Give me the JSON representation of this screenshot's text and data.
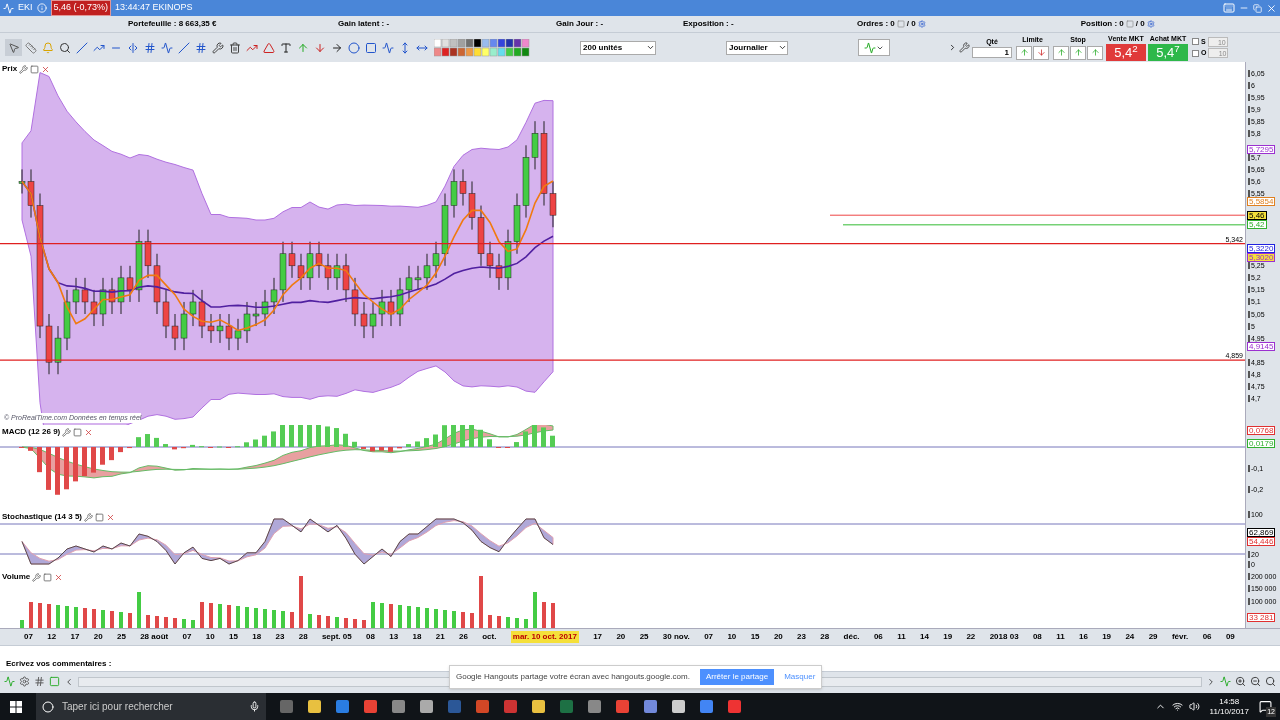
{
  "title_bar": {
    "symbol": "EKI",
    "price_badge": "5,46 (-0,73%)",
    "time_name": "13:44:47 EKINOPS"
  },
  "info_bar": {
    "items": [
      "Portefeuille : 8 663,35 €",
      "Gain latent : -",
      "Gain Jour : -",
      "Exposition : -"
    ],
    "orders": {
      "label": "Ordres : 0",
      "total": "/ 0"
    },
    "position": {
      "label": "Position : 0",
      "total": "/ 0"
    }
  },
  "toolbar": {
    "units": "200 unités",
    "period": "Journalier",
    "qty_label": "Qté",
    "qty": "1",
    "limit_label": "Limite",
    "stop_label": "Stop",
    "sell": {
      "label": "Vente MKT",
      "price": "5,4$^{2}$"
    },
    "buy": {
      "label": "Achat MKT",
      "price": "5,4$^{7}$"
    },
    "options": [
      {
        "label": "S",
        "checked": false,
        "disabled": true,
        "value": "10"
      },
      {
        "label": "O",
        "checked": false,
        "disabled": true,
        "value": "10"
      }
    ]
  },
  "price_pane": {
    "title": "Prix",
    "credit": "© ProRealTime.com Données en temps réel",
    "ticks": [
      "6,05",
      "6",
      "5,95",
      "5,9",
      "5,85",
      "5,8",
      "5,7",
      "5,65",
      "5,6",
      "5,55",
      "5,25",
      "5,2",
      "5,15",
      "5,1",
      "5,05",
      "5",
      "4,95",
      "4,85",
      "4,8",
      "4,75",
      "4,7"
    ],
    "markers": [
      {
        "value": "5,7295",
        "color": "#9b30d0",
        "highlighted": false
      },
      {
        "value": "5,5854",
        "color": "#e08020",
        "highlighted": false
      },
      {
        "value": "5,46",
        "color": "#000000",
        "highlighted": true
      },
      {
        "value": "5,42",
        "color": "#30b030",
        "highlighted": false
      },
      {
        "value": "5,3220",
        "color": "#2020e0",
        "highlighted": false
      },
      {
        "value": "5,3020",
        "color": "#9b30d0",
        "highlighted": true
      },
      {
        "value": "4,9145",
        "color": "#9b30d0",
        "highlighted": false
      }
    ],
    "levels": [
      {
        "label": "5,342"
      },
      {
        "label": "4,859"
      }
    ]
  },
  "macd_pane": {
    "title": "MACD (12 26 9)",
    "ticks": [
      "-0,1",
      "-0,2"
    ],
    "markers": [
      {
        "value": "0,0768",
        "color": "#e03030",
        "highlighted": false
      },
      {
        "value": "0,0179",
        "color": "#30b030",
        "highlighted": false
      }
    ]
  },
  "stoch_pane": {
    "title": "Stochastique (14 3 5)",
    "ticks": [
      "100",
      "20",
      "0"
    ],
    "markers": [
      {
        "value": "62,869",
        "color": "#000000",
        "highlighted": false
      },
      {
        "value": "54,446",
        "color": "#e03030",
        "highlighted": false
      }
    ]
  },
  "volume_pane": {
    "title": "Volume",
    "ticks": [
      "200 000",
      "150 000",
      "100 000"
    ],
    "markers": [
      {
        "value": "33 281",
        "color": "#e03030",
        "highlighted": false
      }
    ]
  },
  "x_axis": [
    {
      "label": "07",
      "selected": false
    },
    {
      "label": "12",
      "selected": false
    },
    {
      "label": "17",
      "selected": false
    },
    {
      "label": "20",
      "selected": false
    },
    {
      "label": "25",
      "selected": false
    },
    {
      "label": "28 août",
      "selected": false
    },
    {
      "label": "07",
      "selected": false
    },
    {
      "label": "10",
      "selected": false
    },
    {
      "label": "15",
      "selected": false
    },
    {
      "label": "18",
      "selected": false
    },
    {
      "label": "23",
      "selected": false
    },
    {
      "label": "28",
      "selected": false
    },
    {
      "label": "sept. 05",
      "selected": false
    },
    {
      "label": "08",
      "selected": false
    },
    {
      "label": "13",
      "selected": false
    },
    {
      "label": "18",
      "selected": false
    },
    {
      "label": "21",
      "selected": false
    },
    {
      "label": "26",
      "selected": false
    },
    {
      "label": "oct.",
      "selected": false
    },
    {
      "label": "mar. 10 oct. 2017",
      "selected": true
    },
    {
      "label": "17",
      "selected": false
    },
    {
      "label": "20",
      "selected": false
    },
    {
      "label": "25",
      "selected": false
    },
    {
      "label": "30 nov.",
      "selected": false
    },
    {
      "label": "07",
      "selected": false
    },
    {
      "label": "10",
      "selected": false
    },
    {
      "label": "15",
      "selected": false
    },
    {
      "label": "20",
      "selected": false
    },
    {
      "label": "23",
      "selected": false
    },
    {
      "label": "28",
      "selected": false
    },
    {
      "label": "déc.",
      "selected": false
    },
    {
      "label": "06",
      "selected": false
    },
    {
      "label": "11",
      "selected": false
    },
    {
      "label": "14",
      "selected": false
    },
    {
      "label": "19",
      "selected": false
    },
    {
      "label": "22",
      "selected": false
    },
    {
      "label": "2018 03",
      "selected": false
    },
    {
      "label": "08",
      "selected": false
    },
    {
      "label": "11",
      "selected": false
    },
    {
      "label": "16",
      "selected": false
    },
    {
      "label": "19",
      "selected": false
    },
    {
      "label": "24",
      "selected": false
    },
    {
      "label": "29",
      "selected": false
    },
    {
      "label": "févr.",
      "selected": false
    },
    {
      "label": "06",
      "selected": false
    },
    {
      "label": "09",
      "selected": false
    }
  ],
  "comments": {
    "label": "Ecrivez vos commentaires :"
  },
  "share_banner": {
    "message": "Google Hangouts partage votre écran avec hangouts.google.com.",
    "stop": "Arrêter le partage",
    "hide": "Masquer"
  },
  "taskbar": {
    "search_placeholder": "Taper ici pour rechercher",
    "time": "14:58",
    "date": "11/10/2017",
    "notifications": "12"
  }
}
